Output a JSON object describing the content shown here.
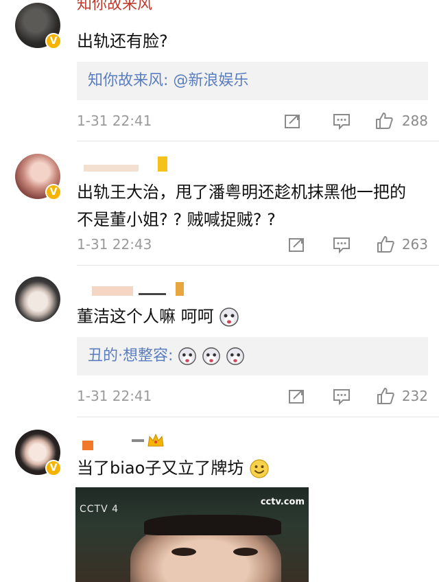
{
  "comments": [
    {
      "name": "知你故来风",
      "text": "出轨还有脸?",
      "reply": {
        "user": "知你故来风:",
        "content": "@新浪娱乐"
      },
      "time": "1-31 22:41",
      "likes": "288"
    },
    {
      "text": "出轨王大治，甩了潘粤明还趁机抹黑他一把的不是董小姐? ? 贼喊捉贼? ?",
      "time": "1-31 22:43",
      "likes": "263"
    },
    {
      "text": "董洁这个人嘛 呵呵",
      "reply": {
        "user": "丑的·想整容:"
      },
      "time": "1-31 22:41",
      "likes": "232"
    },
    {
      "text": "当了biao子又立了牌坊"
    }
  ],
  "video": {
    "channel": "cctv.com",
    "ch_label": "CCTV 4"
  },
  "icons": {
    "verified": "verified-badge-icon",
    "forward": "forward-icon",
    "comment": "comment-icon",
    "like": "thumbs-up-icon",
    "crown": "crown-icon"
  },
  "colors": {
    "link": "#5a7dbf",
    "quote_bg": "#f2f2f2",
    "badge": "#f5b400",
    "meta": "#9a9a9a"
  }
}
